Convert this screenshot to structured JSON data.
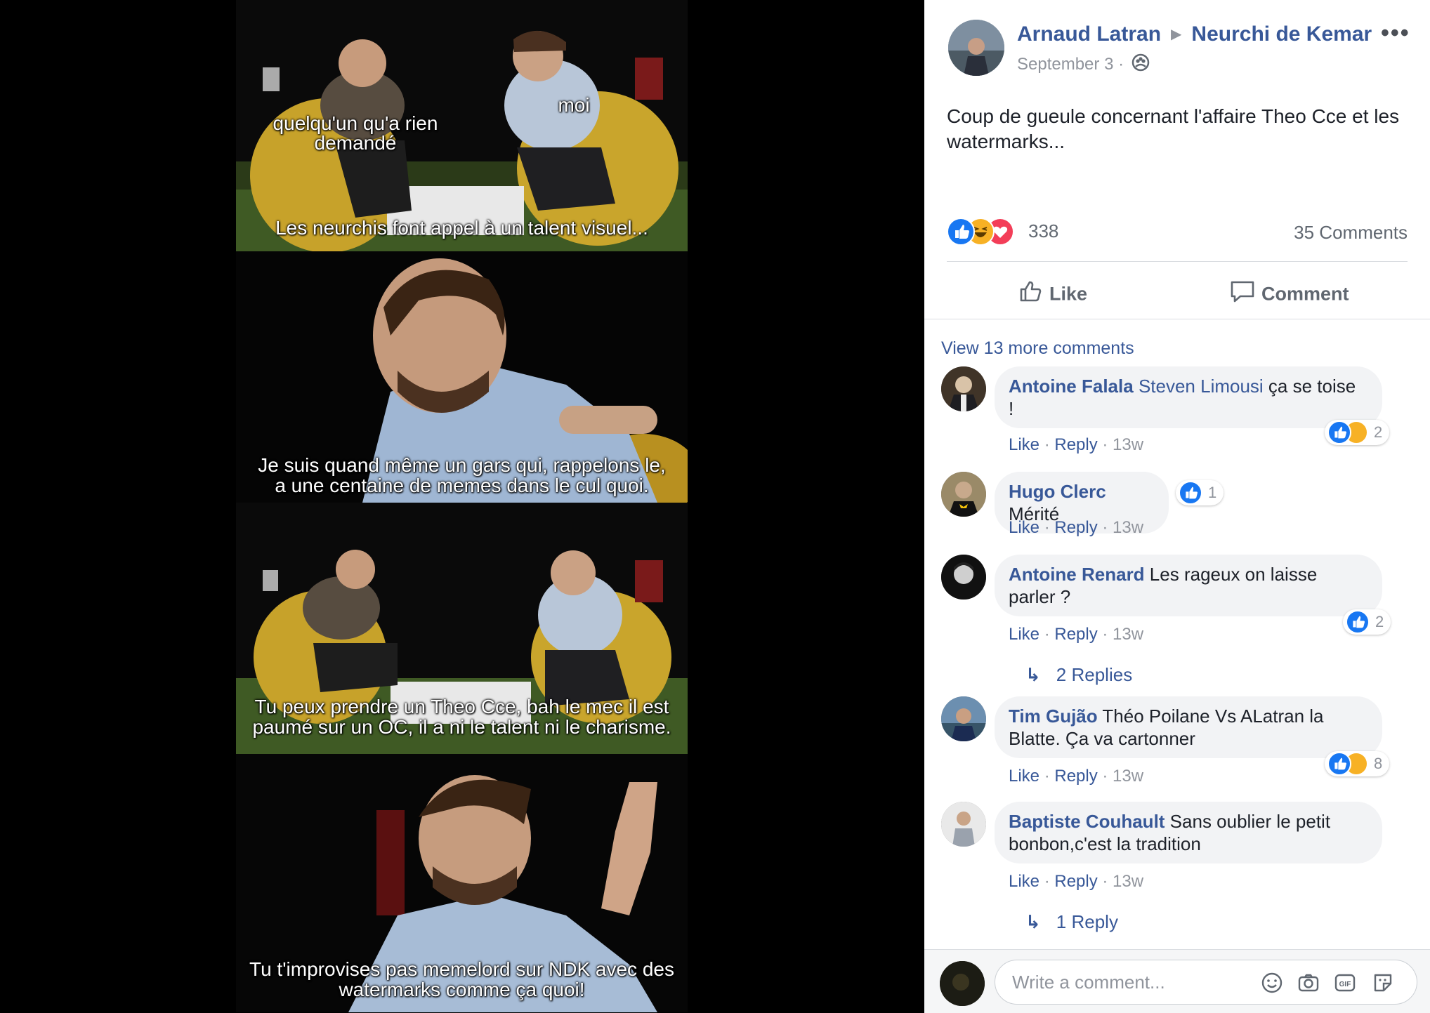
{
  "comic": {
    "panel1": {
      "label_left": "quelqu'un qu'a rien\ndemandé",
      "label_right": "moi",
      "caption": "Les neurchis font appel à un talent visuel..."
    },
    "panel2": {
      "caption": "Je suis quand même un gars qui, rappelons le,\na une centaine de memes dans le cul quoi."
    },
    "panel3": {
      "caption": "Tu peux prendre un Theo Cce, bah le mec il est\npaumé sur un OC, il a ni le talent ni le charisme."
    },
    "panel4": {
      "caption": "Tu t'improvises pas memelord sur NDK avec des\nwatermarks comme ça quoi!"
    }
  },
  "post": {
    "author": "Arnaud Latran",
    "group": "Neurchi de Kemar",
    "date": "September 3 ·",
    "more": "•••",
    "text": "Coup de gueule concernant l'affaire Theo Cce et les watermarks...",
    "reaction_count": "338",
    "comments_count": "35 Comments",
    "like_label": "Like",
    "comment_label": "Comment",
    "view_more": "View 13 more comments",
    "colors": {
      "link": "#385898",
      "like_blue": "#1877f2",
      "haha_yellow": "#f7b125",
      "love_red": "#f33e58"
    }
  },
  "comments": [
    {
      "name": "Antoine Falala",
      "tag": "Steven Limousi",
      "text": " ça se toise !",
      "like": "Like",
      "reply": "Reply",
      "time": "13w",
      "reactions": "2"
    },
    {
      "name": "Hugo Clerc",
      "tag": "",
      "text": " Mérité",
      "like": "Like",
      "reply": "Reply",
      "time": "13w",
      "reactions": "1"
    },
    {
      "name": "Antoine Renard",
      "tag": "",
      "text": " Les rageux on laisse parler ?",
      "like": "Like",
      "reply": "Reply",
      "time": "13w",
      "reactions": "2",
      "replies": "2 Replies"
    },
    {
      "name": "Tim Gujão",
      "tag": "",
      "text": " Théo Poilane Vs ALatran la Blatte. Ça va cartonner",
      "like": "Like",
      "reply": "Reply",
      "time": "13w",
      "reactions": "8"
    },
    {
      "name": "Baptiste Couhault",
      "tag": "",
      "text": " Sans oublier le petit bonbon,c'est la tradition",
      "like": "Like",
      "reply": "Reply",
      "time": "13w",
      "replies": "1 Reply"
    }
  ],
  "composer": {
    "placeholder": "Write a comment..."
  }
}
